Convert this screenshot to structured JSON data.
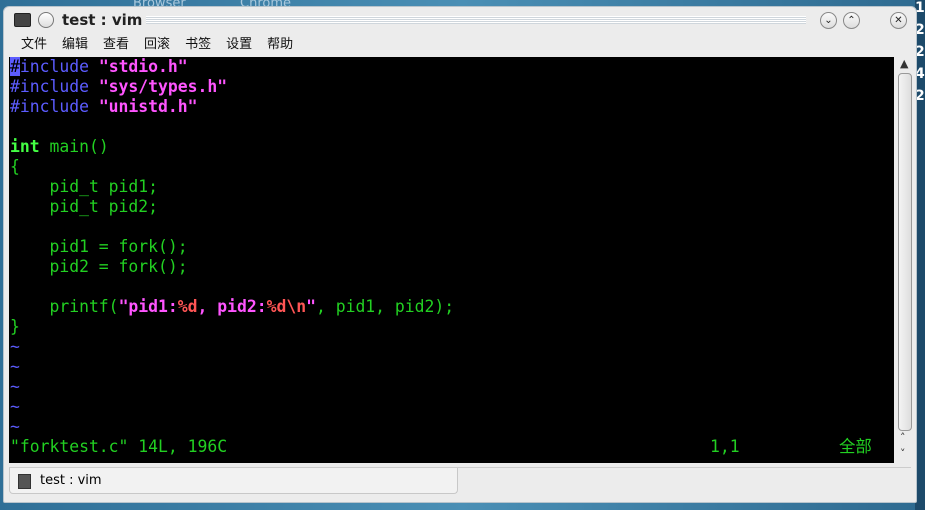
{
  "background": {
    "labels": [
      "Browser",
      "Chrome"
    ],
    "right_digits": [
      "1",
      "2",
      "2",
      "4",
      "2"
    ]
  },
  "window": {
    "title": "test : vim",
    "buttons": {
      "minimize": "⌄",
      "maximize": "⌃",
      "close": "✕"
    }
  },
  "menu": [
    "文件",
    "编辑",
    "查看",
    "回滚",
    "书签",
    "设置",
    "帮助"
  ],
  "code": [
    [
      [
        "cur",
        "#"
      ],
      [
        "b",
        "include "
      ],
      [
        "m",
        "\"stdio.h\""
      ]
    ],
    [
      [
        "b",
        "#include "
      ],
      [
        "m",
        "\"sys/types.h\""
      ]
    ],
    [
      [
        "b",
        "#include "
      ],
      [
        "m",
        "\"unistd.h\""
      ]
    ],
    [],
    [
      [
        "G",
        "int"
      ],
      [
        "g",
        " main()"
      ]
    ],
    [
      [
        "g",
        "{"
      ]
    ],
    [
      [
        "g",
        "    pid_t pid1;"
      ]
    ],
    [
      [
        "g",
        "    pid_t pid2;"
      ]
    ],
    [],
    [
      [
        "g",
        "    pid1 = fork();"
      ]
    ],
    [
      [
        "g",
        "    pid2 = fork();"
      ]
    ],
    [],
    [
      [
        "g",
        "    printf("
      ],
      [
        "m",
        "\"pid1:"
      ],
      [
        "r",
        "%d"
      ],
      [
        "m",
        ", pid2:"
      ],
      [
        "r",
        "%d\\n"
      ],
      [
        "m",
        "\""
      ],
      [
        "g",
        ", pid1, pid2);"
      ]
    ],
    [
      [
        "g",
        "}"
      ]
    ],
    [
      [
        "t",
        "~"
      ]
    ],
    [
      [
        "t",
        "~"
      ]
    ],
    [
      [
        "t",
        "~"
      ]
    ],
    [
      [
        "t",
        "~"
      ]
    ],
    [
      [
        "t",
        "~"
      ]
    ]
  ],
  "status": {
    "file": "\"forktest.c\" 14L, 196C",
    "position": "1,1",
    "scroll": "全部"
  },
  "tab": {
    "label": "test : vim"
  }
}
